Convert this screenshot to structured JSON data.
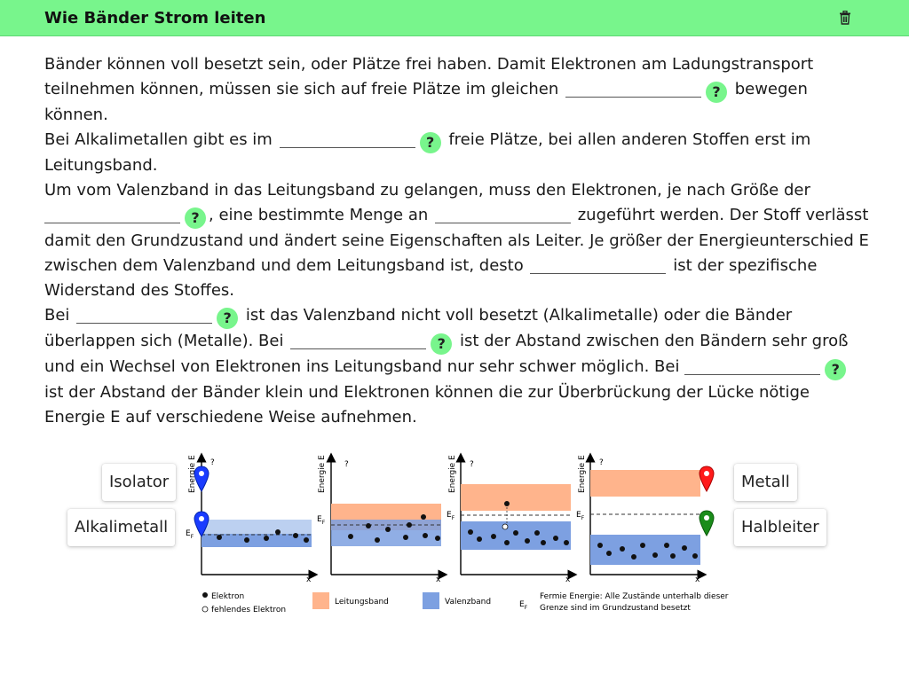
{
  "header": {
    "title": "Wie Bänder Strom leiten"
  },
  "text": {
    "p1a": "Bänder können voll besetzt sein, oder Plätze frei haben. Damit Elektronen am Ladungstransport teilnehmen können, müssen sie sich auf freie Plätze im gleichen",
    "p1b": "bewegen können.",
    "p2a": "Bei Alkalimetallen gibt es im",
    "p2b": "freie Plätze, bei allen anderen Stoffen erst im Leitungsband.",
    "p3a": "Um vom Valenzband in das Leitungsband zu gelangen, muss den Elektronen, je nach Größe der",
    "p3b": ", eine bestimmte Menge an",
    "p3c": "zugeführt werden. Der Stoff verlässt damit den Grundzustand und ändert seine Eigenschaften als Leiter. Je größer der Energieunterschied E zwischen dem Valenzband und dem Leitungsband ist, desto",
    "p3d": "ist der spezifische Widerstand des Stoffes.",
    "p4a": "Bei",
    "p4b": "ist das Valenzband nicht voll besetzt (Alkalimetalle) oder die Bänder überlappen sich (Metalle). Bei",
    "p4c": "ist der Abstand zwischen den Bändern sehr groß und ein Wechsel von Elektronen ins Leitungsband nur sehr schwer möglich. Bei",
    "p4d": "ist der Abstand der Bänder klein und Elektronen können die zur Überbrückung der Lücke nötige Energie E auf verschiedene Weise aufnehmen."
  },
  "help_glyph": "?",
  "labels": {
    "isolator": "Isolator",
    "alkalimetall": "Alkalimetall",
    "metall": "Metall",
    "halbleiter": "Halbleiter"
  },
  "diagram": {
    "axis_y": "Energie E",
    "axis_x": "x",
    "question": "?",
    "ef": "E",
    "ef_sub": "F",
    "legend": {
      "elektron": "Elektron",
      "fehlend": "fehlendes Elektron",
      "leitungsband": "Leitungsband",
      "valenzband": "Valenzband",
      "fermi1": "Fermie Energie: Alle Zustände unterhalb dieser",
      "fermi2": "Grenze sind im Grundzustand besetzt"
    }
  },
  "colors": {
    "accent": "#78f58c",
    "leitungsband": "#ffb48c",
    "valenzband": "#7da0e1",
    "pin_blue": "#1a3cff",
    "pin_red": "#ff1a1a",
    "pin_green": "#1a8c1a"
  }
}
